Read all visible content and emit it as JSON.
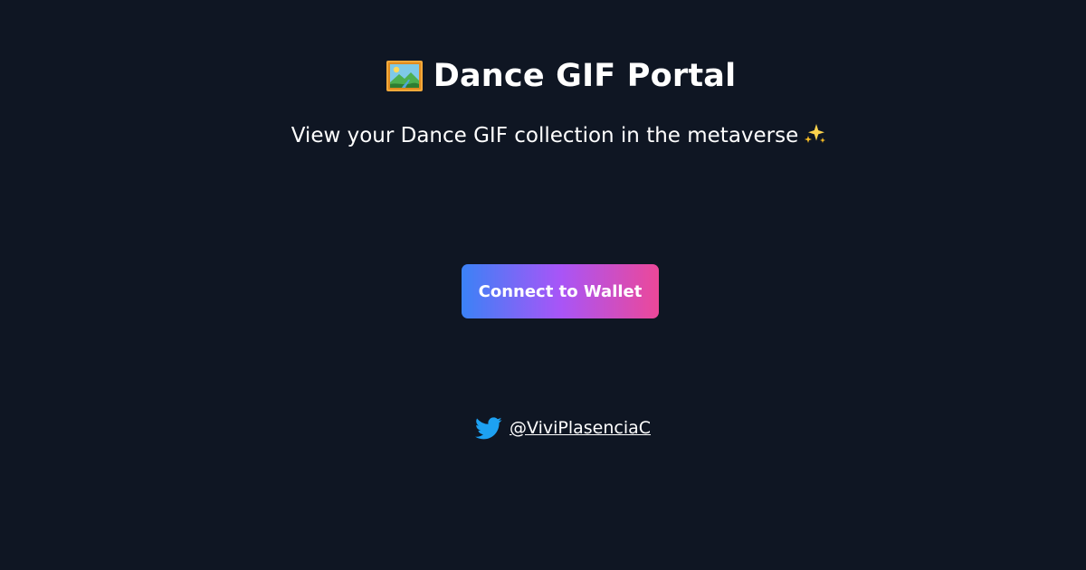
{
  "header": {
    "title": "Dance GIF Portal",
    "icon": "framed-picture-icon"
  },
  "subtitle": {
    "text": "View your Dance GIF collection in the metaverse",
    "icon": "sparkles-icon"
  },
  "connect_button": {
    "label": "Connect to Wallet",
    "gradient": [
      "#3b82f6",
      "#a855f7",
      "#ec4899"
    ]
  },
  "footer": {
    "twitter_handle": "@ViviPlasenciaC",
    "icon": "twitter-icon",
    "icon_color": "#1da1f2"
  },
  "colors": {
    "background": "#0f1623",
    "text": "#ffffff"
  }
}
